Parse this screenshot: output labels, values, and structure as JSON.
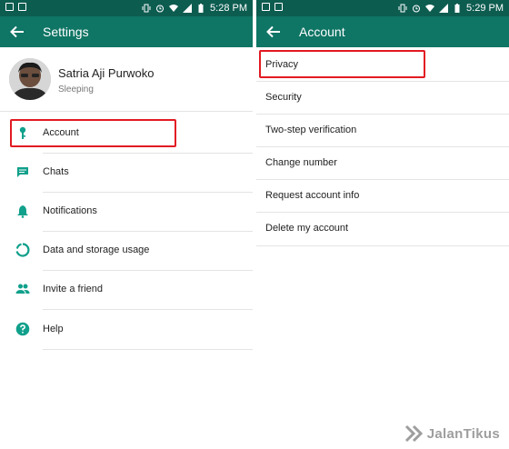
{
  "left": {
    "status_time": "5:28 PM",
    "title": "Settings",
    "profile": {
      "name": "Satria Aji Purwoko",
      "status": "Sleeping"
    },
    "items": [
      {
        "label": "Account",
        "icon": "key-icon"
      },
      {
        "label": "Chats",
        "icon": "chat-icon"
      },
      {
        "label": "Notifications",
        "icon": "bell-icon"
      },
      {
        "label": "Data and storage usage",
        "icon": "data-usage-icon"
      },
      {
        "label": "Invite a friend",
        "icon": "people-icon"
      },
      {
        "label": "Help",
        "icon": "help-icon"
      }
    ]
  },
  "right": {
    "status_time": "5:29 PM",
    "title": "Account",
    "items": [
      {
        "label": "Privacy"
      },
      {
        "label": "Security"
      },
      {
        "label": "Two-step verification"
      },
      {
        "label": "Change number"
      },
      {
        "label": "Request account info"
      },
      {
        "label": "Delete my account"
      }
    ]
  },
  "watermark": "JalanTikus",
  "colors": {
    "status_bar": "#0d5c50",
    "app_bar": "#0f7565",
    "icon_teal": "#10a08b",
    "highlight_red": "#e21a22"
  }
}
